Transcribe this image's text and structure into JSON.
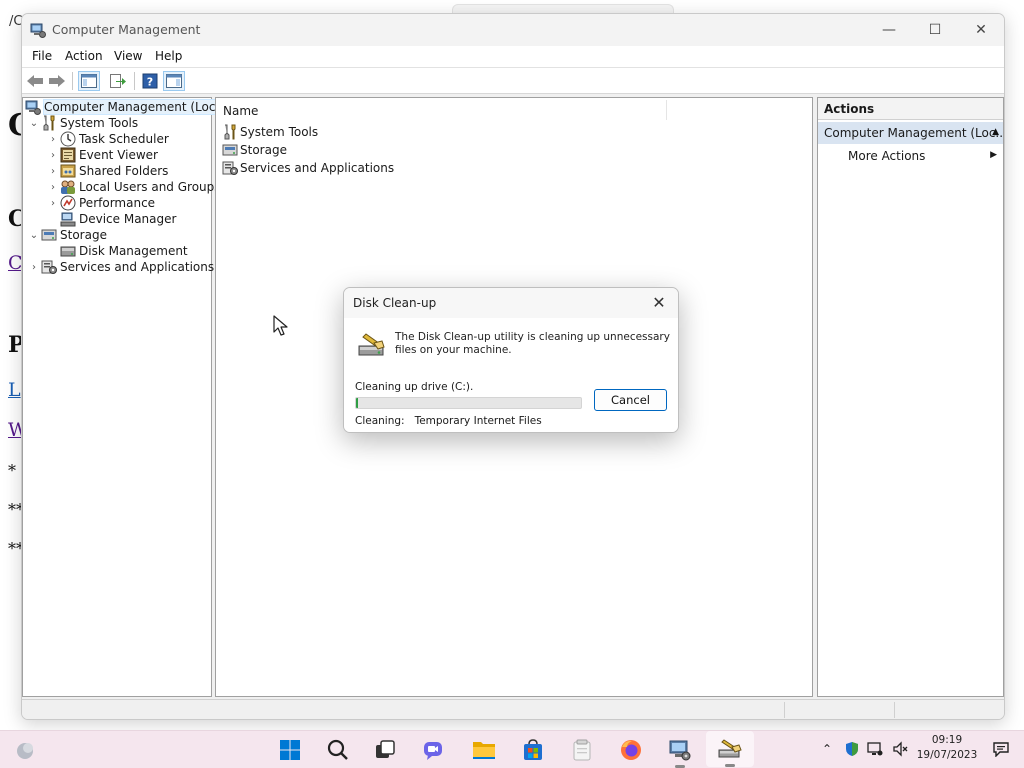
{
  "background_page": {
    "path_fragment": "/C",
    "text_fragments": [
      "C",
      "C",
      "C",
      "P",
      "L",
      "W",
      "* ",
      "**",
      "**"
    ]
  },
  "window": {
    "title": "Computer Management",
    "controls": {
      "minimize": "—",
      "maximize": "☐",
      "close": "✕"
    },
    "menu": [
      "File",
      "Action",
      "View",
      "Help"
    ]
  },
  "tree": {
    "root": "Computer Management (Local)",
    "items": [
      {
        "label": "System Tools",
        "icon": "tools-icon",
        "expander": "expanded"
      },
      {
        "label": "Task Scheduler",
        "icon": "clock-icon",
        "expander": "collapsed"
      },
      {
        "label": "Event Viewer",
        "icon": "event-viewer-icon",
        "expander": "collapsed"
      },
      {
        "label": "Shared Folders",
        "icon": "shared-folder-icon",
        "expander": "collapsed"
      },
      {
        "label": "Local Users and Groups",
        "icon": "users-icon",
        "expander": "collapsed"
      },
      {
        "label": "Performance",
        "icon": "performance-icon",
        "expander": "collapsed"
      },
      {
        "label": "Device Manager",
        "icon": "device-manager-icon",
        "expander": "none"
      },
      {
        "label": "Storage",
        "icon": "storage-icon",
        "expander": "expanded"
      },
      {
        "label": "Disk Management",
        "icon": "disk-icon",
        "expander": "none"
      },
      {
        "label": "Services and Applications",
        "icon": "services-icon",
        "expander": "collapsed"
      }
    ]
  },
  "list": {
    "column_name": "Name",
    "rows": [
      {
        "label": "System Tools",
        "icon": "tools-icon"
      },
      {
        "label": "Storage",
        "icon": "storage-icon"
      },
      {
        "label": "Services and Applications",
        "icon": "services-icon"
      }
    ]
  },
  "actions": {
    "title": "Actions",
    "section": "Computer Management (Loc...",
    "more": "More Actions"
  },
  "dialog": {
    "title": "Disk Clean-up",
    "message": "The Disk Clean-up utility is cleaning up unnecessary files on your machine.",
    "drive_status": "Cleaning up drive  (C:).",
    "progress_fraction": 0.01,
    "cancel_label": "Cancel",
    "cleaning_label": "Cleaning:",
    "cleaning_item": "Temporary Internet Files",
    "accent_color": "#0067c0"
  },
  "taskbar": {
    "time": "09:19",
    "date": "19/07/2023",
    "apps": [
      "start-icon",
      "search-icon",
      "task-view-icon",
      "chat-icon",
      "file-explorer-icon",
      "store-icon",
      "notepad-icon",
      "firefox-icon",
      "computer-management-icon",
      "disk-cleanup-icon"
    ],
    "background_color": "#f5e6ee"
  }
}
